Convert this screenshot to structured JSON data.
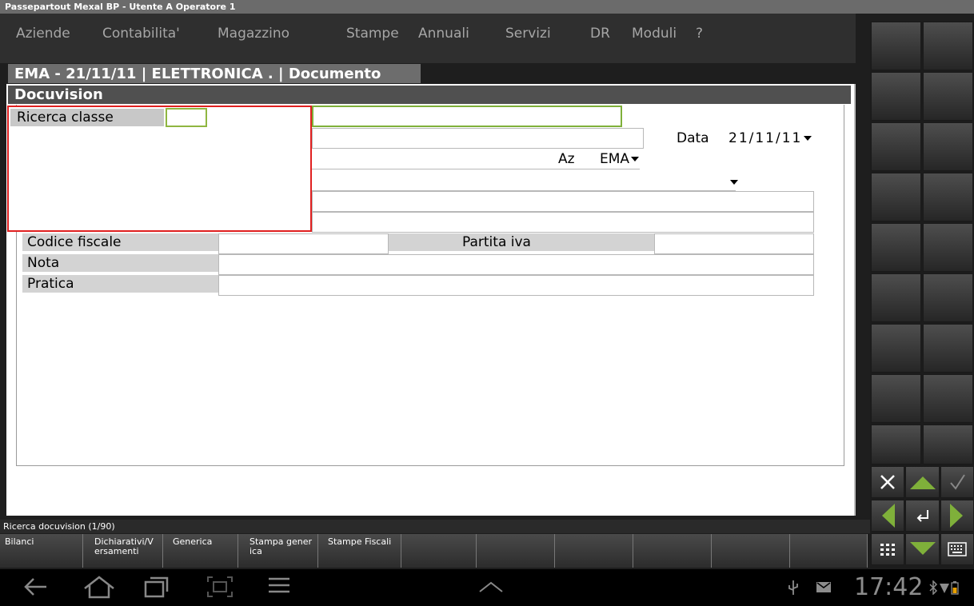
{
  "window": {
    "title": "Passepartout Mexal BP - Utente A Operatore 1"
  },
  "menu": [
    "Aziende",
    "Contabilita'",
    "Magazzino",
    "Stampe",
    "Annuali",
    "Servizi",
    "DR",
    "Moduli",
    "?"
  ],
  "window_tab": "EMA - 21/11/11 | ELETTRONICA . | Documento",
  "panel": {
    "title": "Docuvision"
  },
  "popup": {
    "label": "Ricerca classe",
    "value": ""
  },
  "form": {
    "data_label": "Data",
    "data_value": "21/11/11",
    "az_label": "Az",
    "az_value": "EMA",
    "codice_fiscale_label": "Codice fiscale",
    "partita_iva_label": "Partita iva",
    "nota_label": "Nota",
    "pratica_label": "Pratica"
  },
  "status": {
    "text": "Ricerca docuvision (1/90)"
  },
  "function_keys": [
    "Bilanci",
    "Dichiarativi/V ersamenti",
    "Generica",
    "Stampa gener ica",
    "Stampe Fiscali",
    "",
    "",
    "",
    "",
    "",
    ""
  ],
  "system": {
    "time": "17:42"
  },
  "colors": {
    "accent_green": "#7fb03a",
    "popup_border": "#e02020",
    "label_bg": "#d3d3d3"
  }
}
